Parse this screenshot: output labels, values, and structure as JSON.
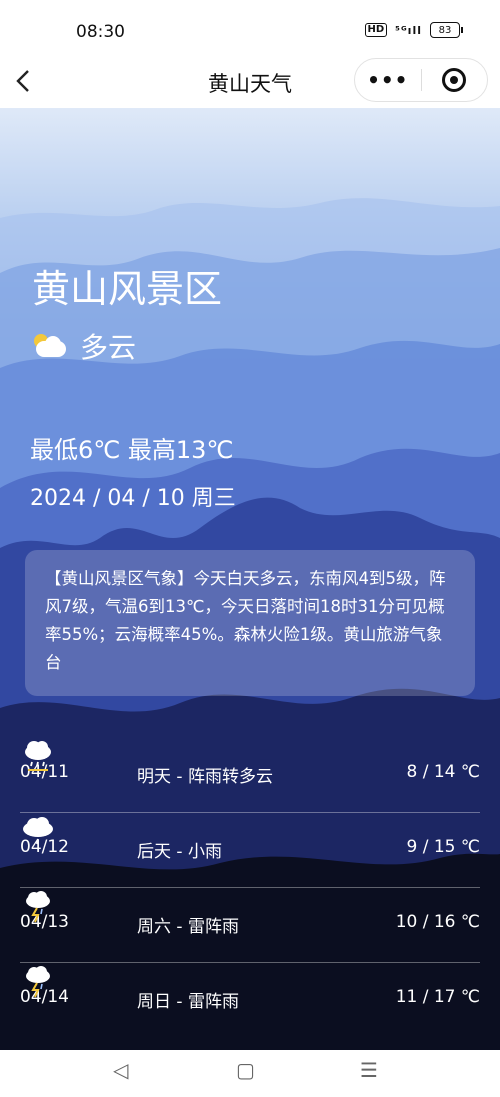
{
  "status": {
    "time": "08:30",
    "hd": "HD",
    "signal": "⁵ᴳıll",
    "battery": "83"
  },
  "nav": {
    "back_glyph": "‹",
    "title": "黄山天气",
    "more_glyph": "•••"
  },
  "hero": {
    "place": "黄山风景区",
    "weather": "多云",
    "temp_range": "最低6℃ 最高13℃",
    "date": "2024 / 04 / 10  周三",
    "description": "【黄山风景区气象】今天白天多云，东南风4到5级，阵风7级，气温6到13℃，今天日落时间18时31分可见概率55%；云海概率45%。森林火险1级。黄山旅游气象台"
  },
  "forecast": [
    {
      "date": "04/11",
      "desc": "明天 - 阵雨转多云",
      "icon": "rain-sun-icon",
      "temp": "8 / 14 ℃"
    },
    {
      "date": "04/12",
      "desc": "后天 - 小雨",
      "icon": "light-rain-icon",
      "temp": "9 / 15 ℃"
    },
    {
      "date": "04/13",
      "desc": "周六 - 雷阵雨",
      "icon": "thunderstorm-icon",
      "temp": "10 / 16 ℃"
    },
    {
      "date": "04/14",
      "desc": "周日 - 雷阵雨",
      "icon": "thunderstorm-icon",
      "temp": "11 / 17 ℃"
    }
  ],
  "system_nav": {
    "back": "◁",
    "home": "▢",
    "menu": "☰"
  }
}
